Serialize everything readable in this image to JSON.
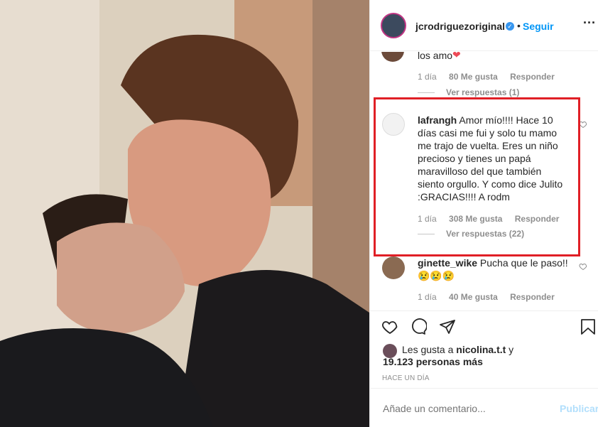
{
  "post": {
    "username": "jcrodriguezoriginal",
    "follow_label": "Seguir",
    "verified_icon": "verified-badge-icon"
  },
  "comments": [
    {
      "text": "los amo",
      "emoji": "❤",
      "time": "1 día",
      "likes": "80 Me gusta",
      "reply_label": "Responder",
      "view_replies": "Ver respuestas (1)"
    },
    {
      "username": "lafrangh",
      "lines": [
        "Amor mío!!!! Hace 10",
        "días casi me fui y solo tu mamo",
        "me trajo de vuelta. Eres un niño",
        "precioso y tienes un papá",
        "maravilloso del que también",
        "siento orgullo. Y como dice Julito",
        ":GRACIAS!!!! A rodm"
      ],
      "time": "1 día",
      "likes": "308 Me gusta",
      "reply_label": "Responder",
      "view_replies": "Ver respuestas (22)"
    },
    {
      "username": "ginette_wike",
      "text": "Pucha que le paso!!",
      "emoji": "😢😢😢",
      "time": "1 día",
      "likes": "40 Me gusta",
      "reply_label": "Responder"
    }
  ],
  "likes_summary": {
    "prefix": "Les gusta a",
    "user": "nicolina.t.t",
    "conj": "y",
    "count_text": "19.123 personas más"
  },
  "timestamp": "HACE UN DÍA",
  "add_comment": {
    "placeholder": "Añade un comentario...",
    "publish_label": "Publicar"
  },
  "colors": {
    "accent": "#0095f6",
    "highlight": "#e01f26",
    "secondary_text": "#8e8e8e",
    "heart_red": "#ed4956"
  }
}
